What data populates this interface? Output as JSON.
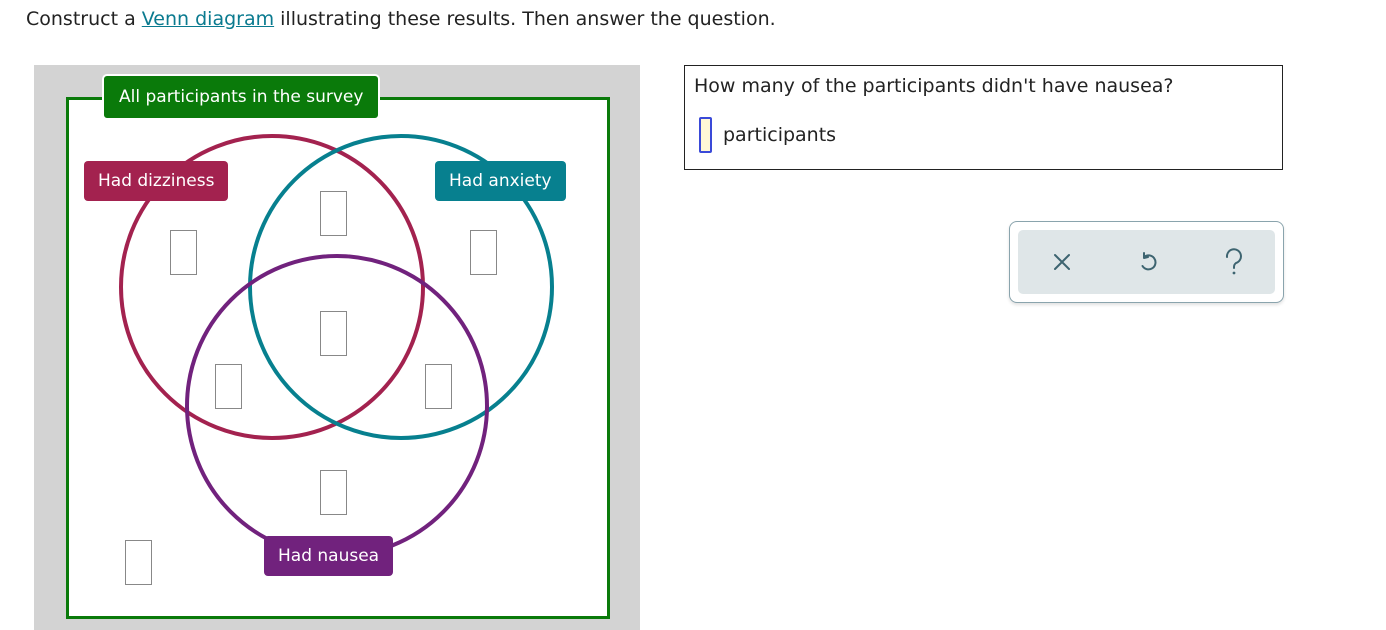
{
  "instruction": {
    "prefix": "Construct a ",
    "link_text": "Venn diagram",
    "suffix": " illustrating these results. Then answer the question."
  },
  "venn": {
    "universe_label": "All participants in the survey",
    "sets": [
      {
        "name": "dizziness",
        "label": "Had dizziness",
        "color": "#a3224f"
      },
      {
        "name": "anxiety",
        "label": "Had anxiety",
        "color": "#07808f"
      },
      {
        "name": "nausea",
        "label": "Had nausea",
        "color": "#71227d"
      }
    ],
    "universe_color": "#0a7a0a",
    "regions": [
      {
        "name": "dizziness-only",
        "value": ""
      },
      {
        "name": "dizziness-anxiety-only",
        "value": ""
      },
      {
        "name": "anxiety-only",
        "value": ""
      },
      {
        "name": "all-three",
        "value": ""
      },
      {
        "name": "dizziness-nausea-only",
        "value": ""
      },
      {
        "name": "anxiety-nausea-only",
        "value": ""
      },
      {
        "name": "nausea-only",
        "value": ""
      },
      {
        "name": "none",
        "value": ""
      }
    ]
  },
  "question": {
    "text": "How many of the participants didn't have nausea?",
    "answer_value": "",
    "unit": "participants"
  },
  "toolbar": {
    "clear": "close-icon",
    "undo": "undo-icon",
    "help": "help-icon"
  }
}
